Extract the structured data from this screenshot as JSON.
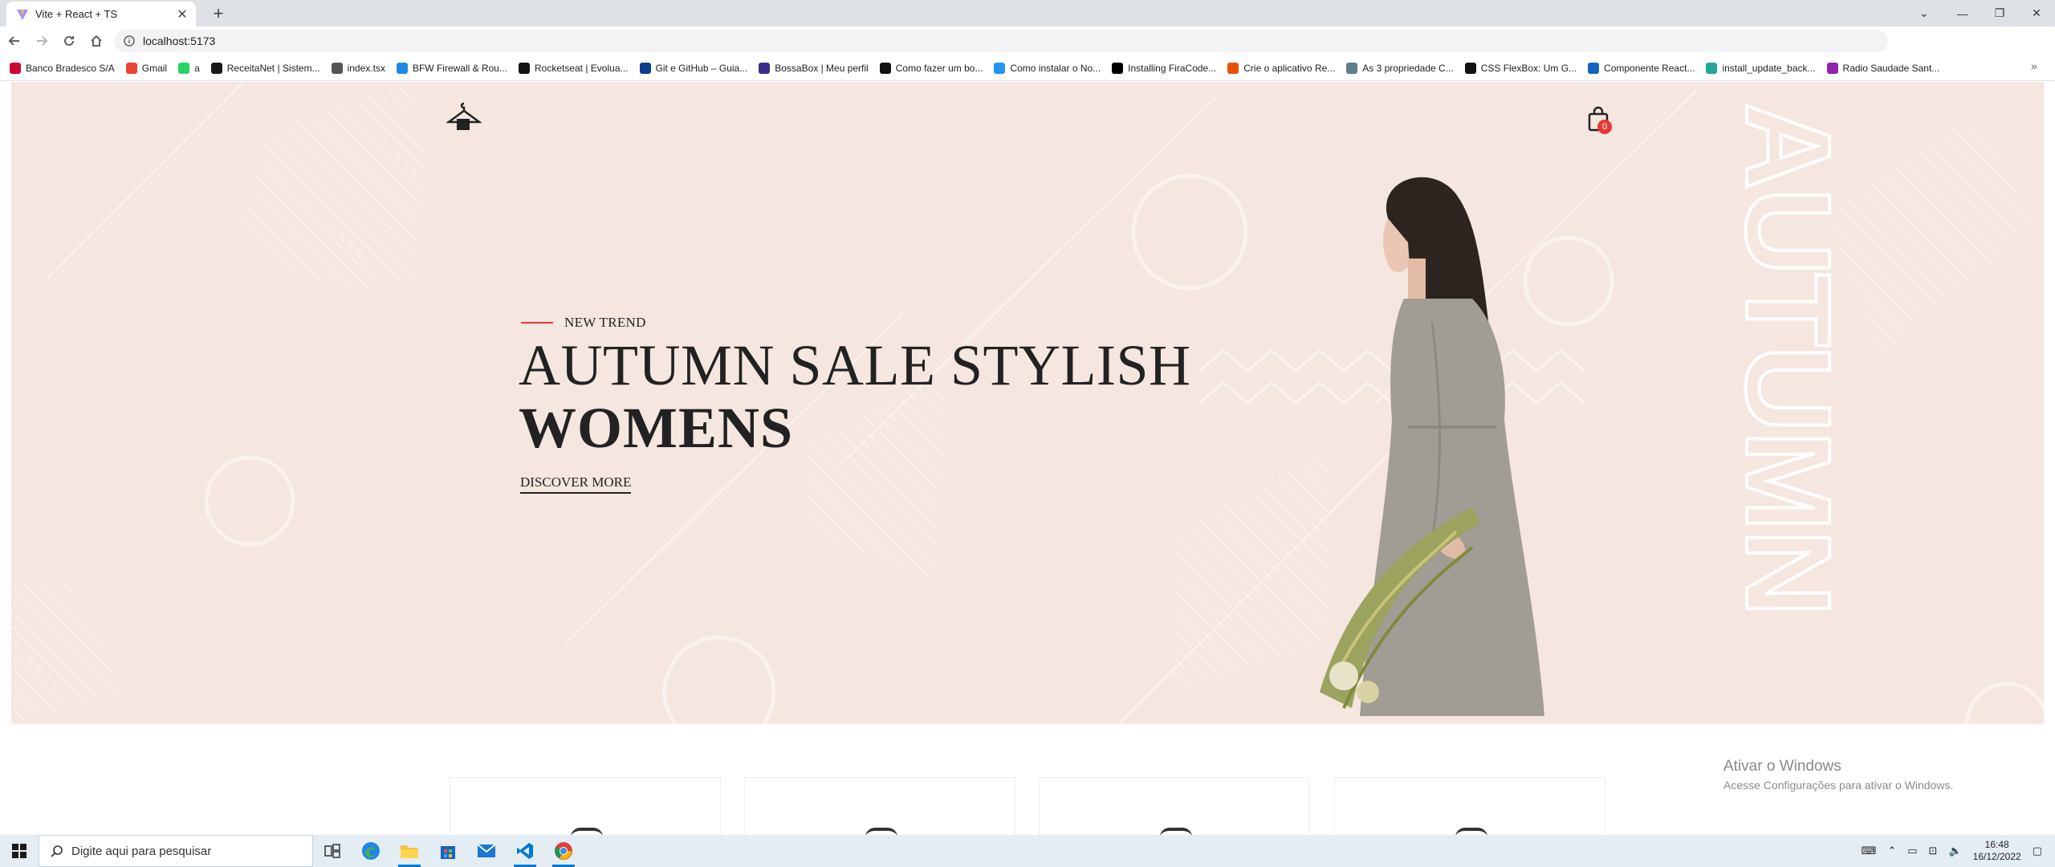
{
  "browser": {
    "tab_title": "Vite + React + TS",
    "url": "localhost:5173",
    "bookmarks": [
      {
        "label": "Banco Bradesco S/A",
        "color": "#cc092f"
      },
      {
        "label": "Gmail",
        "color": "#ea4335"
      },
      {
        "label": "a",
        "color": "#25d366"
      },
      {
        "label": "ReceitaNet | Sistem...",
        "color": "#1a1a1a"
      },
      {
        "label": "index.tsx",
        "color": "#555555"
      },
      {
        "label": "BFW Firewall & Rou...",
        "color": "#1e88e5"
      },
      {
        "label": "Rocketseat | Evolua...",
        "color": "#121214"
      },
      {
        "label": "Git e GitHub – Guia...",
        "color": "#0b3d91"
      },
      {
        "label": "BossaBox | Meu perfil",
        "color": "#3c2c8c"
      },
      {
        "label": "Como fazer um bo...",
        "color": "#121214"
      },
      {
        "label": "Como instalar o No...",
        "color": "#2196f3"
      },
      {
        "label": "Installing FiraCode...",
        "color": "#000000"
      },
      {
        "label": "Crie o aplicativo Re...",
        "color": "#e65100"
      },
      {
        "label": "As 3 propriedade C...",
        "color": "#607d8b"
      },
      {
        "label": "CSS FlexBox: Um G...",
        "color": "#111111"
      },
      {
        "label": "Componente React...",
        "color": "#1565c0"
      },
      {
        "label": "install_update_back...",
        "color": "#26a69a"
      },
      {
        "label": "Radio Saudade Sant...",
        "color": "#8e24aa"
      }
    ]
  },
  "hero": {
    "eyebrow": "NEW TREND",
    "headline_line1": "AUTUMN SALE STYLISH",
    "headline_line2": "WOMENS",
    "cta": "DISCOVER MORE",
    "side_word": "AUTUMN",
    "cart_count": "0",
    "background_color": "#f5e6e0",
    "accent_color": "#e53935"
  },
  "watermark": {
    "line1": "Ativar o Windows",
    "line2": "Acesse Configurações para ativar o Windows."
  },
  "taskbar": {
    "search_placeholder": "Digite aqui para pesquisar",
    "time": "16:48",
    "date": "16/12/2022",
    "apps": [
      "task-view-icon",
      "edge-icon",
      "file-explorer-icon",
      "store-icon",
      "mail-icon",
      "vscode-icon",
      "chrome-icon"
    ]
  }
}
